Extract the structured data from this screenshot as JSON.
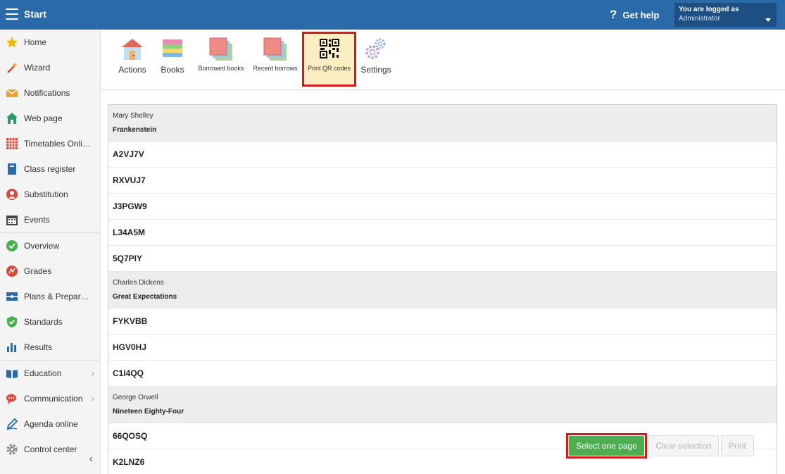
{
  "topbar": {
    "start_label": "Start",
    "help_label": "Get help",
    "help_icon": "?",
    "login_line1": "You are logged as",
    "login_line2": "Administrator"
  },
  "sidebar": {
    "items": [
      {
        "label": "Home",
        "icon": "star-icon",
        "color": "#f5b800"
      },
      {
        "label": "Wizard",
        "icon": "magic-wand-icon",
        "color": "#d94a2a"
      },
      {
        "label": "Notifications",
        "icon": "envelope-icon",
        "color": "#f0a030"
      },
      {
        "label": "Web page",
        "icon": "house-icon",
        "color": "#2a9d6a"
      },
      {
        "label": "Timetables Online",
        "icon": "grid-icon",
        "color": "#d94a3a"
      },
      {
        "label": "Class register",
        "icon": "book-icon",
        "color": "#2b6aa8"
      },
      {
        "label": "Substitution",
        "icon": "person-icon",
        "color": "#d94a3a"
      },
      {
        "label": "Events",
        "icon": "calendar-icon",
        "color": "#444444"
      },
      {
        "label": "Overview",
        "icon": "check-circle-icon",
        "color": "#43b049"
      },
      {
        "label": "Grades",
        "icon": "grades-circle-icon",
        "color": "#d94a3a"
      },
      {
        "label": "Plans & Preparations",
        "icon": "plan-icon",
        "color": "#2b6aa8"
      },
      {
        "label": "Standards",
        "icon": "shield-check-icon",
        "color": "#43b049"
      },
      {
        "label": "Results",
        "icon": "bar-chart-icon",
        "color": "#2b6aa8"
      },
      {
        "label": "Education",
        "icon": "open-book-icon",
        "color": "#2b6aa8"
      },
      {
        "label": "Communication",
        "icon": "chat-icon",
        "color": "#d94a3a"
      },
      {
        "label": "Agenda online",
        "icon": "pen-icon",
        "color": "#2b6aa8"
      },
      {
        "label": "Control center",
        "icon": "gear-icon",
        "color": "#888888"
      }
    ]
  },
  "toolbar": {
    "actions": "Actions",
    "books": "Books",
    "borrowed": "Borrowed books",
    "recent": "Recent borrows",
    "print_qr": "Print QR codes",
    "settings": "Settings"
  },
  "groups": [
    {
      "author": "Mary Shelley",
      "title": "Frankenstein",
      "codes": [
        "A2VJ7V",
        "RXVUJ7",
        "J3PGW9",
        "L34A5M",
        "5Q7PIY"
      ]
    },
    {
      "author": "Charles Dickens",
      "title": "Great Expectations",
      "codes": [
        "FYKVBB",
        "HGV0HJ",
        "C1I4QQ"
      ]
    },
    {
      "author": "George Orwell",
      "title": "Nineteen Eighty-Four",
      "codes": [
        "66QOSQ",
        "K2LNZ6"
      ]
    }
  ],
  "buttons": {
    "select_page": "Select one page",
    "clear_selection": "Clear selection",
    "print": "Print"
  },
  "colors": {
    "topbar": "#2b6aa8",
    "highlight_border": "#d7181f",
    "select_green": "#4cae4f"
  }
}
